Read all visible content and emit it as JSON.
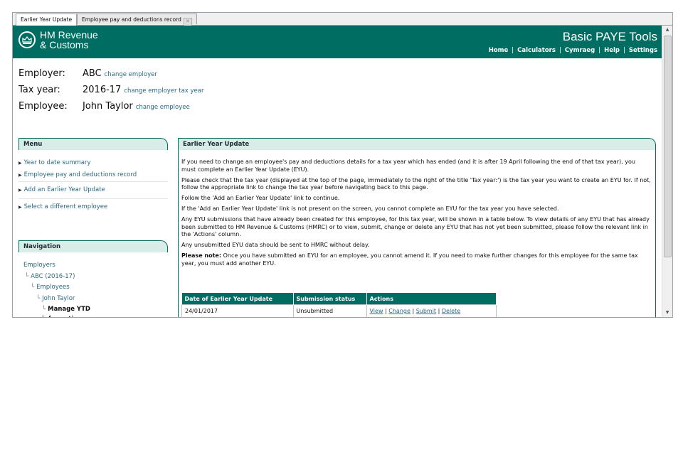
{
  "tabs": [
    {
      "label": "Earlier Year Update",
      "active": true
    },
    {
      "label": "Employee pay and deductions record",
      "active": false
    }
  ],
  "header": {
    "org_line1": "HM Revenue",
    "org_line2": "& Customs",
    "app_title": "Basic PAYE Tools",
    "nav": [
      "Home",
      "Calculators",
      "Cymraeg",
      "Help",
      "Settings"
    ],
    "brand_color": "#006d62"
  },
  "info": {
    "employer_label": "Employer:",
    "employer_value": "ABC",
    "employer_link": "change employer",
    "taxyear_label": "Tax year:",
    "taxyear_value": "2016-17",
    "taxyear_link": "change employer tax year",
    "employee_label": "Employee:",
    "employee_value": "John Taylor",
    "employee_link": "change employee"
  },
  "menu": {
    "title": "Menu",
    "items": [
      "Year to date summary",
      "Employee pay and deductions record",
      "Add an Earlier Year Update",
      "Select a different employee"
    ]
  },
  "navigation": {
    "title": "Navigation",
    "items": [
      "Employers",
      "ABC (2016-17)",
      "Employees",
      "John Taylor",
      "Manage YTD information"
    ]
  },
  "main": {
    "title": "Earlier Year Update",
    "paragraphs": [
      "If you need to change an employee's pay and deductions details for a tax year which has ended (and it is after 19 April following the end of that tax year), you must complete an Earlier Year Update (EYU).",
      "Please check that the tax year (displayed at the top of the page, immediately to the right of the title 'Tax year:') is the tax year you want to create an EYU for. If not, follow the appropriate link to change the tax year before navigating back to this page.",
      "Follow the 'Add an Earlier Year Update' link to continue.",
      "If the 'Add an Earlier Year Update' link is not present on the screen, you cannot complete an EYU for the tax year you have selected.",
      "Any EYU submissions that have already been created for this employee, for this tax year, will be shown in a table below. To view details of any EYU that has already been submitted to HM Revenue & Customs (HMRC) or to view, submit, change or delete any EYU that has not yet been submitted, please follow the relevant link in the 'Actions' column.",
      "Any unsubmitted EYU data should be sent to HMRC without delay."
    ],
    "note_label": "Please note:",
    "note_text": "Once you have submitted an EYU for an employee, you cannot amend it. If you need to make further changes for this employee for the same tax year, you must add another EYU."
  },
  "table": {
    "headers": [
      "Date of Earlier Year Update",
      "Submission status",
      "Actions"
    ],
    "rows": [
      {
        "date": "24/01/2017",
        "status": "Unsubmitted",
        "actions": [
          "View",
          "Change",
          "Submit",
          "Delete"
        ]
      }
    ]
  }
}
